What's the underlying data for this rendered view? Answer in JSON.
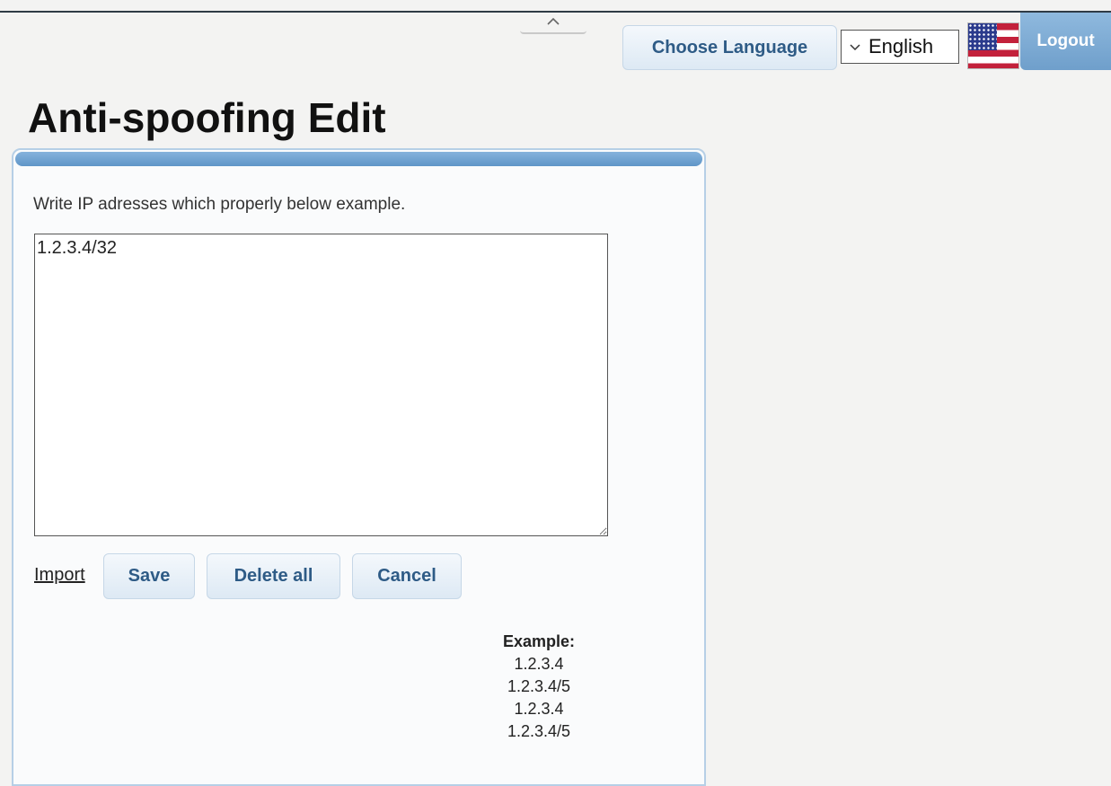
{
  "header": {
    "choose_language_label": "Choose Language",
    "language_selected": "English",
    "logout_label": "Logout"
  },
  "icons": {
    "collapse": "chevron-up-icon",
    "dropdown": "chevron-down-icon",
    "flag": "us-flag-icon"
  },
  "colors": {
    "accent": "#6f9fcb",
    "button_text": "#2e5b86",
    "panel_border": "#b6cfe6"
  },
  "page": {
    "title": "Anti-spoofing Edit"
  },
  "form": {
    "instruction": "Write IP adresses which properly below example.",
    "textarea_value": "1.2.3.4/32",
    "import_label": "Import",
    "save_label": "Save",
    "delete_all_label": "Delete all",
    "cancel_label": "Cancel"
  },
  "example": {
    "title": "Example:",
    "lines": [
      "1.2.3.4",
      "1.2.3.4/5",
      "1.2.3.4",
      "1.2.3.4/5"
    ]
  }
}
